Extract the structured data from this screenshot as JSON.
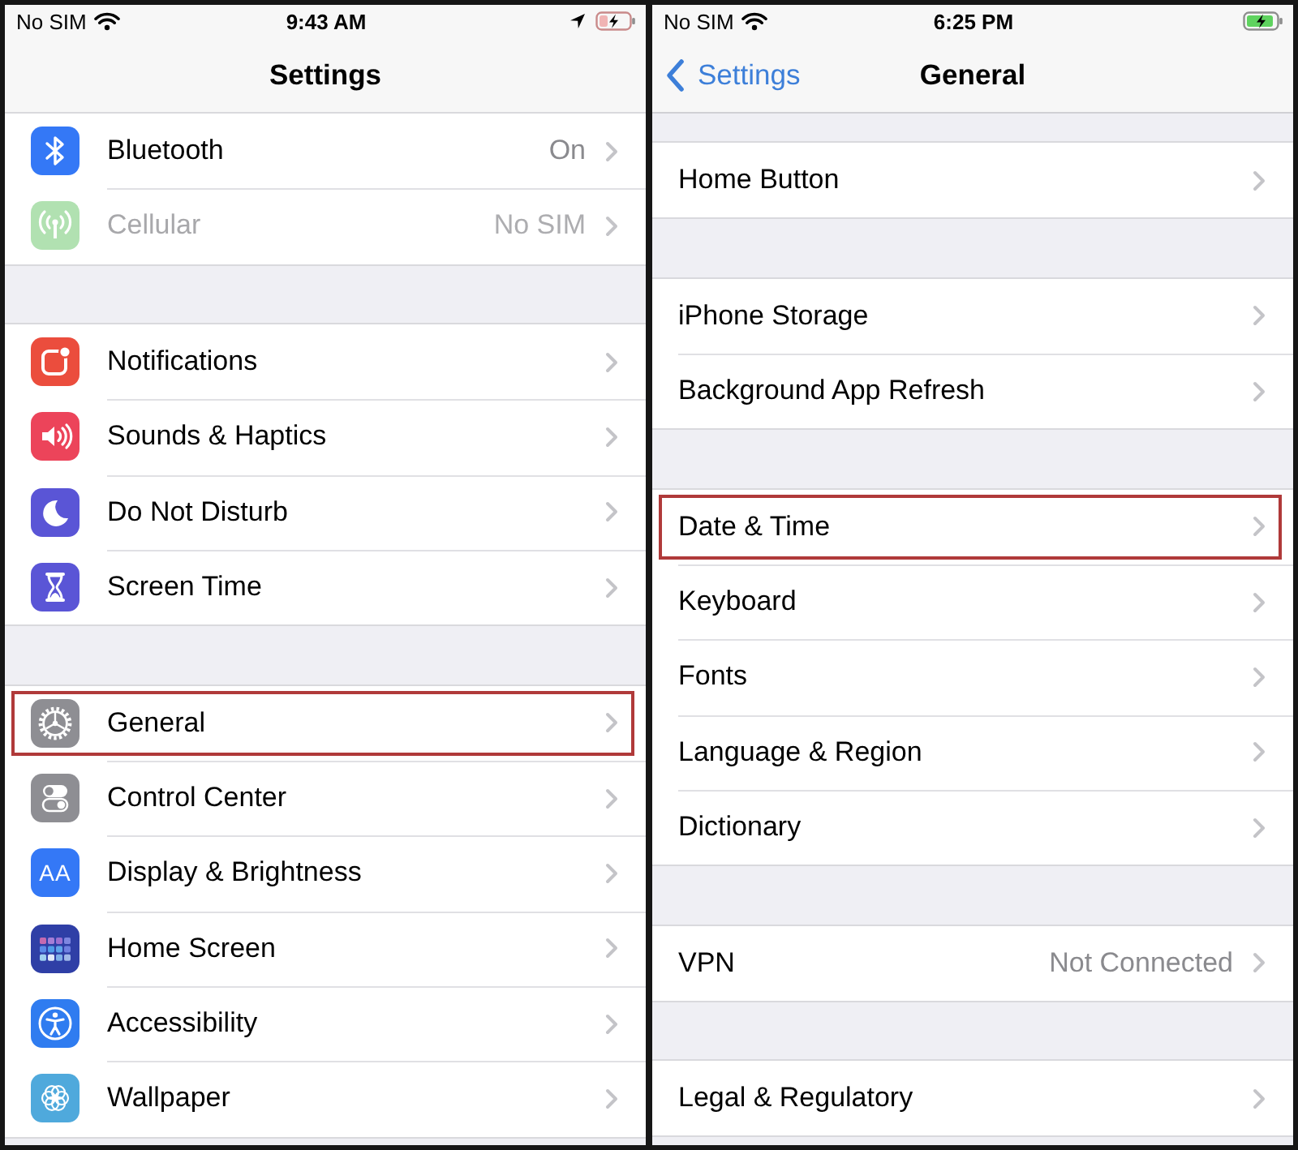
{
  "screens": [
    {
      "status_bar": {
        "carrier": "No SIM",
        "time": "9:43 AM",
        "location": true,
        "battery": {
          "kind": "low"
        }
      },
      "nav": {
        "title": "Settings"
      },
      "groups": [
        {
          "rows": [
            {
              "kind": "bluetooth",
              "label": "Bluetooth",
              "value": "On",
              "disabled": false,
              "highlighted": false
            },
            {
              "kind": "antenna",
              "label": "Cellular",
              "value": "No SIM",
              "disabled": true,
              "highlighted": false
            }
          ]
        },
        {
          "rows": [
            {
              "kind": "notifications",
              "label": "Notifications",
              "disabled": false,
              "highlighted": false
            },
            {
              "kind": "speaker",
              "label": "Sounds & Haptics",
              "disabled": false,
              "highlighted": false
            },
            {
              "kind": "moon",
              "label": "Do Not Disturb",
              "disabled": false,
              "highlighted": false
            },
            {
              "kind": "hourglass",
              "label": "Screen Time",
              "disabled": false,
              "highlighted": false
            }
          ]
        },
        {
          "rows": [
            {
              "kind": "gear",
              "label": "General",
              "disabled": false,
              "highlighted": true
            },
            {
              "kind": "toggles",
              "label": "Control Center",
              "disabled": false,
              "highlighted": false
            },
            {
              "kind": "textsize",
              "icon_text": "AA",
              "label": "Display & Brightness",
              "disabled": false,
              "highlighted": false
            },
            {
              "kind": "grid",
              "label": "Home Screen",
              "disabled": false,
              "highlighted": false
            },
            {
              "kind": "accessibility",
              "label": "Accessibility",
              "disabled": false,
              "highlighted": false
            },
            {
              "kind": "flower",
              "label": "Wallpaper",
              "disabled": false,
              "highlighted": false
            }
          ]
        }
      ]
    },
    {
      "status_bar": {
        "carrier": "No SIM",
        "time": "6:25 PM",
        "location": false,
        "battery": {
          "kind": "charged"
        }
      },
      "nav": {
        "back": "Settings",
        "title": "General"
      },
      "groups": [
        {
          "rows": [
            {
              "kind": "plain",
              "label": "Home Button",
              "disabled": false,
              "highlighted": false
            }
          ]
        },
        {
          "rows": [
            {
              "kind": "plain",
              "label": "iPhone Storage",
              "disabled": false,
              "highlighted": false
            },
            {
              "kind": "plain",
              "label": "Background App Refresh",
              "disabled": false,
              "highlighted": false
            }
          ]
        },
        {
          "rows": [
            {
              "kind": "plain",
              "label": "Date & Time",
              "disabled": false,
              "highlighted": true
            },
            {
              "kind": "plain",
              "label": "Keyboard",
              "disabled": false,
              "highlighted": false
            },
            {
              "kind": "plain",
              "label": "Fonts",
              "disabled": false,
              "highlighted": false
            },
            {
              "kind": "plain",
              "label": "Language & Region",
              "disabled": false,
              "highlighted": false
            },
            {
              "kind": "plain",
              "label": "Dictionary",
              "disabled": false,
              "highlighted": false
            }
          ]
        },
        {
          "rows": [
            {
              "kind": "plain",
              "label": "VPN",
              "value": "Not Connected",
              "disabled": false,
              "highlighted": false
            }
          ]
        },
        {
          "rows": [
            {
              "kind": "plain",
              "label": "Legal & Regulatory",
              "disabled": false,
              "highlighted": false
            }
          ]
        }
      ]
    }
  ]
}
